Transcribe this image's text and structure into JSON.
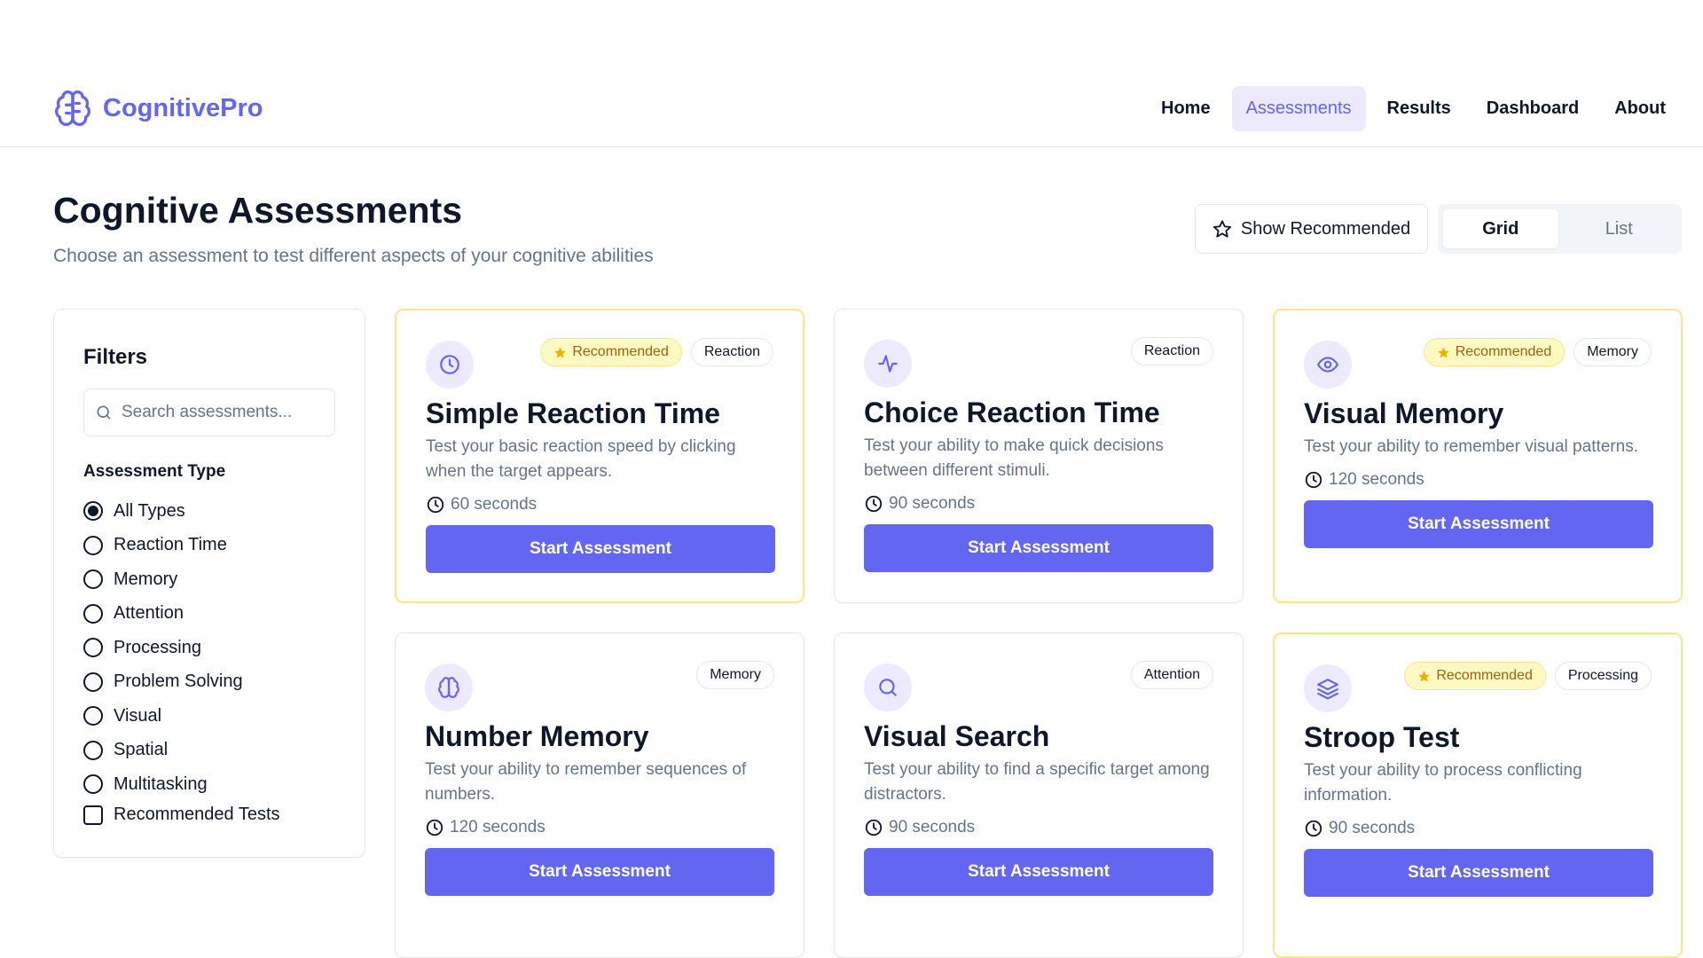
{
  "header": {
    "logo_text": "CognitivePro",
    "nav": [
      {
        "label": "Home",
        "active": false
      },
      {
        "label": "Assessments",
        "active": true
      },
      {
        "label": "Results",
        "active": false
      },
      {
        "label": "Dashboard",
        "active": false
      },
      {
        "label": "About",
        "active": false
      }
    ]
  },
  "page": {
    "title": "Cognitive Assessments",
    "subtitle": "Choose an assessment to test different aspects of your cognitive abilities",
    "show_recommended_label": "Show Recommended",
    "view_options": {
      "grid": "Grid",
      "list": "List",
      "selected": "Grid"
    }
  },
  "filters": {
    "title": "Filters",
    "search_placeholder": "Search assessments...",
    "type_label": "Assessment Type",
    "types": [
      "All Types",
      "Reaction Time",
      "Memory",
      "Attention",
      "Processing",
      "Problem Solving",
      "Visual",
      "Spatial",
      "Multitasking"
    ],
    "selected_type": "All Types",
    "recommended_label": "Recommended Tests",
    "recommended_checked": false
  },
  "cards": [
    {
      "title": "Simple Reaction Time",
      "description": "Test your basic reaction speed by clicking when the target appears.",
      "duration": "60 seconds",
      "category": "Reaction",
      "recommended": true,
      "recommended_label": "Recommended",
      "icon": "clock-icon",
      "button": "Start Assessment"
    },
    {
      "title": "Choice Reaction Time",
      "description": "Test your ability to make quick decisions between different stimuli.",
      "duration": "90 seconds",
      "category": "Reaction",
      "recommended": false,
      "recommended_label": "",
      "icon": "activity-icon",
      "button": "Start Assessment"
    },
    {
      "title": "Visual Memory",
      "description": "Test your ability to remember visual patterns.",
      "duration": "120 seconds",
      "category": "Memory",
      "recommended": true,
      "recommended_label": "Recommended",
      "icon": "eye-icon",
      "button": "Start Assessment"
    },
    {
      "title": "Number Memory",
      "description": "Test your ability to remember sequences of numbers.",
      "duration": "120 seconds",
      "category": "Memory",
      "recommended": false,
      "recommended_label": "",
      "icon": "brain-icon",
      "button": "Start Assessment"
    },
    {
      "title": "Visual Search",
      "description": "Test your ability to find a specific target among distractors.",
      "duration": "90 seconds",
      "category": "Attention",
      "recommended": false,
      "recommended_label": "",
      "icon": "search-icon",
      "button": "Start Assessment"
    },
    {
      "title": "Stroop Test",
      "description": "Test your ability to process conflicting information.",
      "duration": "90 seconds",
      "category": "Processing",
      "recommended": true,
      "recommended_label": "Recommended",
      "icon": "layers-icon",
      "button": "Start Assessment"
    }
  ],
  "colors": {
    "accent": "#6366f1",
    "accent_light": "#ede9fe",
    "recommended_bg": "#fef9c3",
    "recommended_border": "#fde68a",
    "recommended_text": "#a16207",
    "star": "#eab308"
  }
}
